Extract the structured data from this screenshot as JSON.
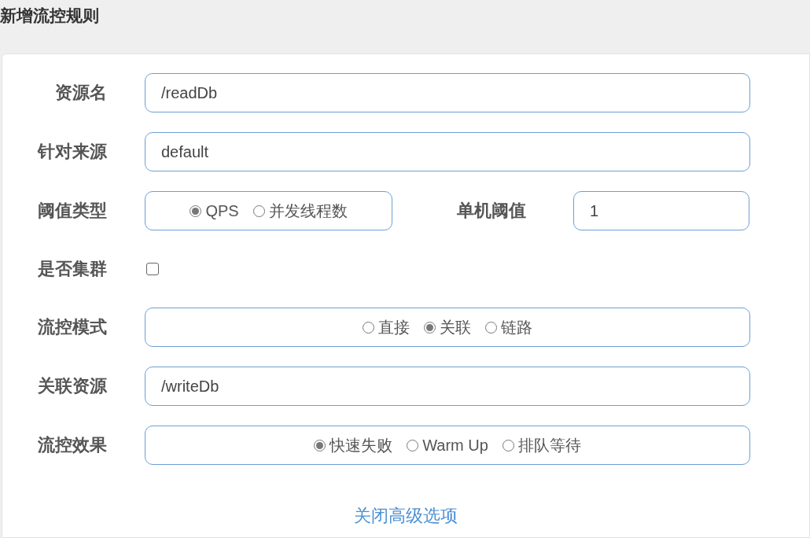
{
  "title": "新增流控规则",
  "rows": [
    {
      "kind": "text",
      "label": "资源名",
      "value": "/readDb"
    },
    {
      "kind": "text",
      "label": "针对来源",
      "value": "default"
    },
    {
      "kind": "radio_split",
      "label": "阈值类型",
      "options": [
        {
          "label": "QPS",
          "selected": true
        },
        {
          "label": "并发线程数",
          "selected": false
        }
      ],
      "second": {
        "label": "单机阈值",
        "value": "1"
      }
    },
    {
      "kind": "checkbox",
      "label": "是否集群",
      "checked": false
    },
    {
      "kind": "radio",
      "label": "流控模式",
      "options": [
        {
          "label": "直接",
          "selected": false
        },
        {
          "label": "关联",
          "selected": true
        },
        {
          "label": "链路",
          "selected": false
        }
      ]
    },
    {
      "kind": "text",
      "label": "关联资源",
      "value": "/writeDb"
    },
    {
      "kind": "radio",
      "label": "流控效果",
      "options": [
        {
          "label": "快速失败",
          "selected": true
        },
        {
          "label": "Warm Up",
          "selected": false
        },
        {
          "label": "排队等待",
          "selected": false
        }
      ]
    }
  ],
  "link": "关闭高级选项"
}
